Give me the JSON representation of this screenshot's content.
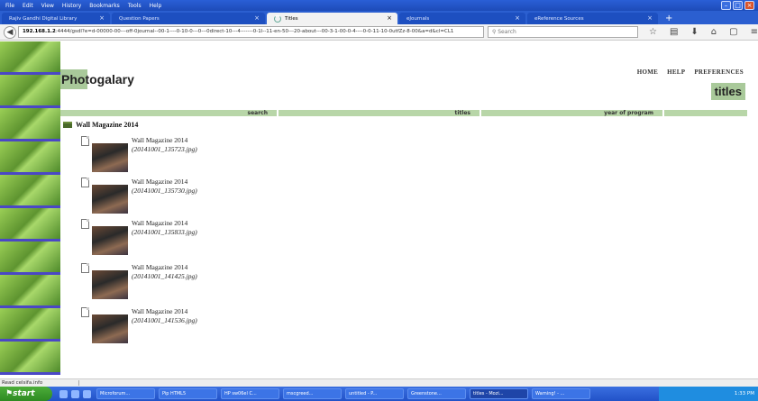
{
  "menubar": {
    "items": [
      "File",
      "Edit",
      "View",
      "History",
      "Bookmarks",
      "Tools",
      "Help"
    ]
  },
  "tabs": [
    {
      "label": "Rajiv Gandhi Digital Library"
    },
    {
      "label": "Question Papers"
    },
    {
      "label": "Titles"
    },
    {
      "label": "eJournals"
    },
    {
      "label": "eReference Sources"
    }
  ],
  "navbar": {
    "url_host": "192.168.1.2",
    "url_rest": ":4444/gsdl?e=d-00000-00---off-0journal--00-1----0-10-0---0---0direct-10---4-------0-1l--11-en-50---20-about---00-3-1-00-0-4----0-0-11-10-0utfZz-8-00&a=d&cl=CL1",
    "search_placeholder": "Search",
    "icons": [
      "star-icon",
      "bookmark-list-icon",
      "download-icon",
      "home-icon",
      "reader-icon",
      "menu-icon"
    ]
  },
  "page": {
    "title": "Photogalary",
    "links": [
      "HOME",
      "HELP",
      "PREFERENCES"
    ],
    "section": "titles",
    "nav": [
      "search",
      "titles",
      "year of program"
    ],
    "collection": "Wall Magazine 2014",
    "items": [
      {
        "title": "Wall Magazine 2014",
        "file": "(20141001_135723.jpg)"
      },
      {
        "title": "Wall Magazine 2014",
        "file": "(20141001_135730.jpg)"
      },
      {
        "title": "Wall Magazine 2014",
        "file": "(20141001_135833.jpg)"
      },
      {
        "title": "Wall Magazine 2014",
        "file": "(20141001_141425.jpg)"
      },
      {
        "title": "Wall Magazine 2014",
        "file": "(20141001_141536.jpg)"
      }
    ]
  },
  "status": {
    "text": "Read celsifa.info"
  },
  "taskbar": {
    "start": "start",
    "tasks": [
      "Microforum...",
      "Pip HTML5",
      "HP sw06el C...",
      "mscgreed...",
      "untitled - P...",
      "Greenstone...",
      "titles - Mozi...",
      "Warning! - ..."
    ],
    "clock": "1:33 PM"
  },
  "colors": {
    "accent_green": "#a9c99a",
    "nav_green": "#b8d6a8",
    "taskbar_blue": "#2252c8",
    "leaf_divider": "#4a47c6"
  }
}
